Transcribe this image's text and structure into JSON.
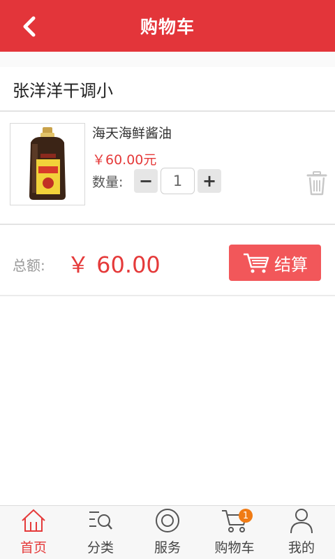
{
  "header": {
    "title": "购物车"
  },
  "shop": {
    "name": "张洋洋干调小"
  },
  "cart_item": {
    "name": "海天海鲜酱油",
    "price": "￥60.00元",
    "qty_label": "数量:",
    "quantity": "1",
    "minus": "−",
    "plus": "+"
  },
  "summary": {
    "total_label": "总额:",
    "total_value": "￥ 60.00",
    "checkout_label": "结算"
  },
  "tabbar": {
    "tabs": [
      {
        "label": "首页",
        "icon": "home-icon"
      },
      {
        "label": "分类",
        "icon": "category-search-icon"
      },
      {
        "label": "服务",
        "icon": "service-icon"
      },
      {
        "label": "购物车",
        "icon": "cart-icon",
        "badge": "1"
      },
      {
        "label": "我的",
        "icon": "user-icon"
      }
    ]
  },
  "colors": {
    "brand": "#e3353a",
    "price": "#e53a3a",
    "checkout": "#f2575a",
    "badge": "#f07b14"
  }
}
